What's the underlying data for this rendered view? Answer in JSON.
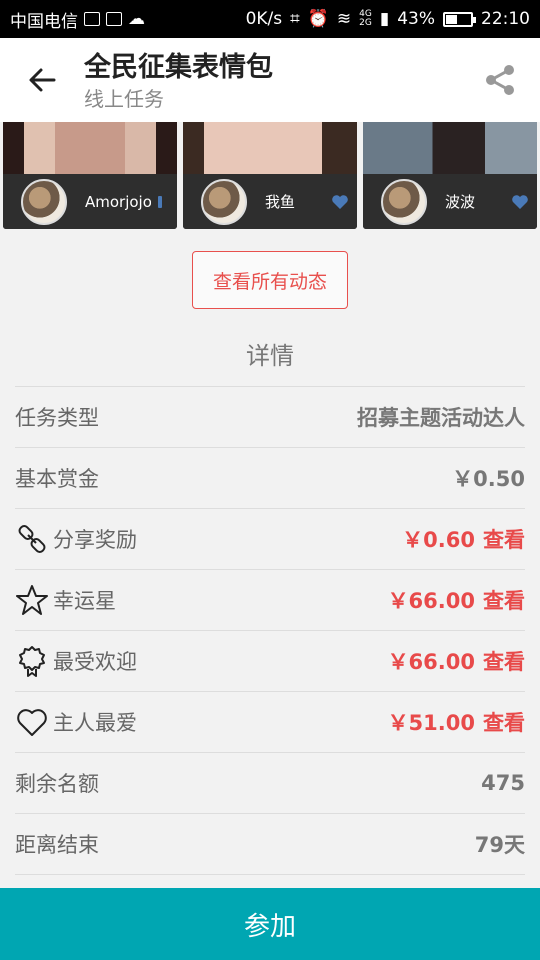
{
  "status_bar": {
    "carrier": "中国电信",
    "speed": "0K/s",
    "network_top": "4G",
    "network_bottom": "2G",
    "battery": "43%",
    "battery_level": 0.43,
    "time": "22:10"
  },
  "header": {
    "title": "全民征集表情包",
    "subtitle": "线上任务"
  },
  "cards": [
    {
      "name": "Amorjojo"
    },
    {
      "name": "我鱼"
    },
    {
      "name": "波波"
    }
  ],
  "view_all_label": "查看所有动态",
  "details": {
    "title": "详情",
    "rows": [
      {
        "label": "任务类型",
        "value": "招募主题活动达人"
      },
      {
        "label": "基本赏金",
        "value": "￥0.50"
      },
      {
        "label": "分享奖励",
        "value": "￥0.60",
        "link": "查看",
        "icon": "link-icon"
      },
      {
        "label": "幸运星",
        "value": "￥66.00",
        "link": "查看",
        "icon": "star-icon"
      },
      {
        "label": "最受欢迎",
        "value": "￥66.00",
        "link": "查看",
        "icon": "badge-icon"
      },
      {
        "label": "主人最爱",
        "value": "￥51.00",
        "link": "查看",
        "icon": "heart-icon"
      },
      {
        "label": "剩余名额",
        "value": "475"
      },
      {
        "label": "距离结束",
        "value": "79天"
      }
    ]
  },
  "join_label": "参加",
  "colors": {
    "accent": "#e84a4a",
    "primary": "#00a6b2"
  }
}
